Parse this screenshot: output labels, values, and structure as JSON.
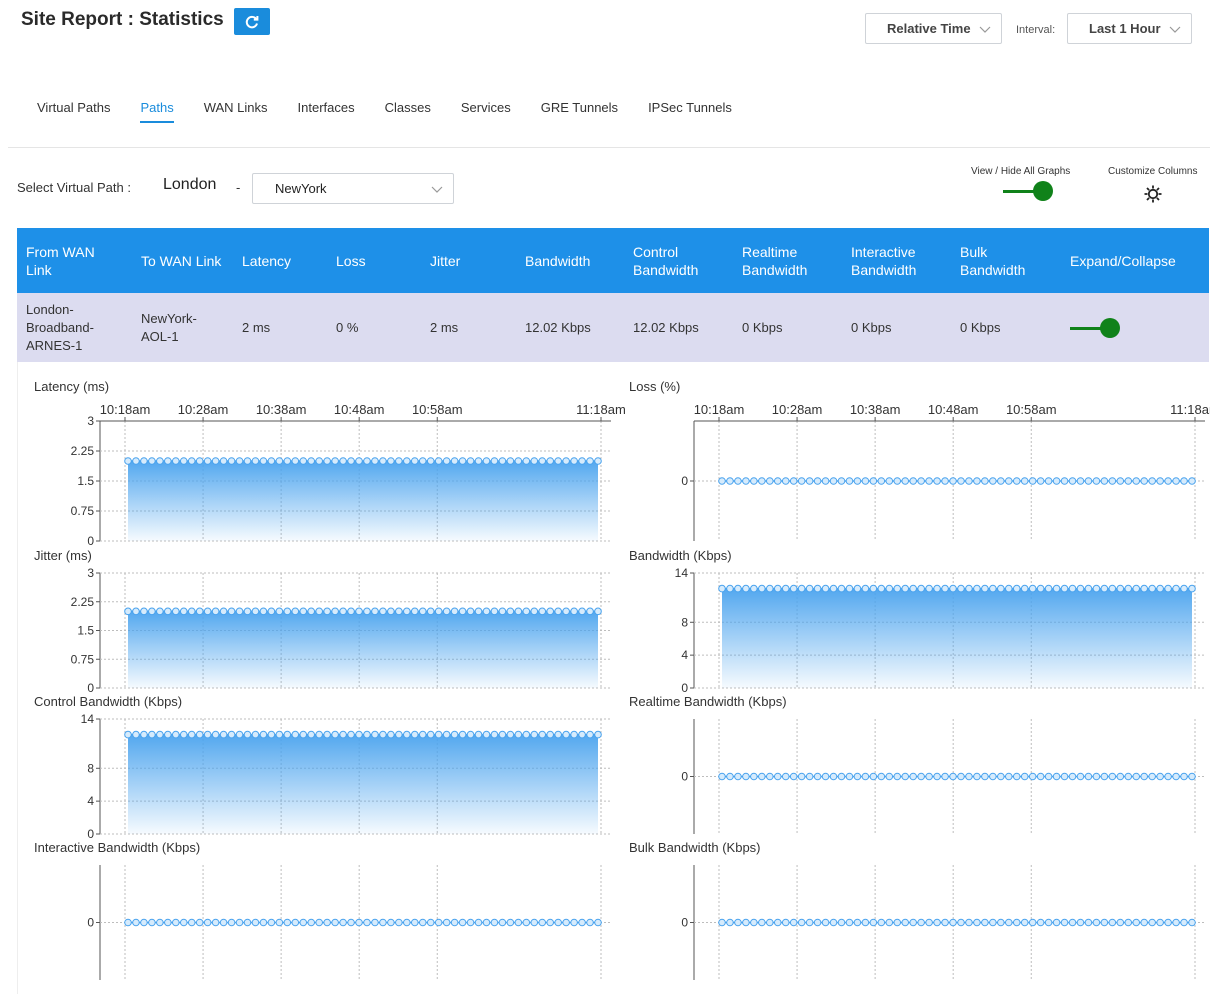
{
  "header": {
    "title": "Site Report : Statistics"
  },
  "time_mode": {
    "label": "Relative Time"
  },
  "interval": {
    "label": "Interval:",
    "value": "Last 1 Hour"
  },
  "tabs": [
    "Virtual Paths",
    "Paths",
    "WAN Links",
    "Interfaces",
    "Classes",
    "Services",
    "GRE Tunnels",
    "IPSec Tunnels"
  ],
  "active_tab": "Paths",
  "selector": {
    "label": "Select Virtual Path :",
    "source": "London",
    "separator": "-",
    "destination": "NewYork"
  },
  "controls": {
    "view_hide_label": "View / Hide All Graphs",
    "view_hide_on": true,
    "customize_label": "Customize Columns"
  },
  "table": {
    "columns": [
      "From WAN Link",
      "To WAN Link",
      "Latency",
      "Loss",
      "Jitter",
      "Bandwidth",
      "Control Bandwidth",
      "Realtime Bandwidth",
      "Interactive Bandwidth",
      "Bulk Bandwidth",
      "Expand/Collapse"
    ],
    "rows": [
      {
        "from": "London-Broadband-ARNES-1",
        "to": "NewYork-AOL-1",
        "latency": "2 ms",
        "loss": "0 %",
        "jitter": "2 ms",
        "bandwidth": "12.02 Kbps",
        "control": "12.02 Kbps",
        "realtime": "0 Kbps",
        "interactive": "0 Kbps",
        "bulk": "0 Kbps",
        "expanded": true
      }
    ]
  },
  "colors": {
    "accent": "#1a8cdc",
    "header_bg": "#1e90e8",
    "toggle": "#10821a",
    "row_bg": "#dcdcf0",
    "series": "#4aa3ee"
  },
  "chart_data": [
    {
      "type": "area",
      "title": "Latency (ms)",
      "x_ticks": [
        "10:18am",
        "10:28am",
        "10:38am",
        "10:48am",
        "10:58am",
        "11:18am"
      ],
      "y_ticks": [
        "3",
        "2.25",
        "1.5",
        "0.75",
        "0"
      ],
      "ylim": [
        0,
        3
      ],
      "points": 60,
      "value": 2,
      "filled": true
    },
    {
      "type": "line",
      "title": "Loss (%)",
      "x_ticks": [
        "10:18am",
        "10:28am",
        "10:38am",
        "10:48am",
        "10:58am",
        "11:18am"
      ],
      "y_ticks": [
        "0"
      ],
      "points": 60,
      "value": 0,
      "filled": false
    },
    {
      "type": "area",
      "title": "Jitter (ms)",
      "y_ticks": [
        "3",
        "2.25",
        "1.5",
        "0.75",
        "0"
      ],
      "ylim": [
        0,
        3
      ],
      "points": 60,
      "value": 2,
      "filled": true
    },
    {
      "type": "area",
      "title": "Bandwidth (Kbps)",
      "y_ticks": [
        "14",
        "8",
        "4",
        "0"
      ],
      "ylim": [
        0,
        14
      ],
      "points": 60,
      "value": 12.1,
      "filled": true
    },
    {
      "type": "area",
      "title": "Control Bandwidth (Kbps)",
      "y_ticks": [
        "14",
        "8",
        "4",
        "0"
      ],
      "ylim": [
        0,
        14
      ],
      "points": 60,
      "value": 12.1,
      "filled": true
    },
    {
      "type": "line",
      "title": "Realtime Bandwidth (Kbps)",
      "y_ticks": [
        "0"
      ],
      "points": 60,
      "value": 0,
      "filled": false
    },
    {
      "type": "line",
      "title": "Interactive Bandwidth (Kbps)",
      "y_ticks": [
        "0"
      ],
      "points": 60,
      "value": 0,
      "filled": false
    },
    {
      "type": "line",
      "title": "Bulk Bandwidth (Kbps)",
      "y_ticks": [
        "0"
      ],
      "points": 60,
      "value": 0,
      "filled": false
    }
  ]
}
